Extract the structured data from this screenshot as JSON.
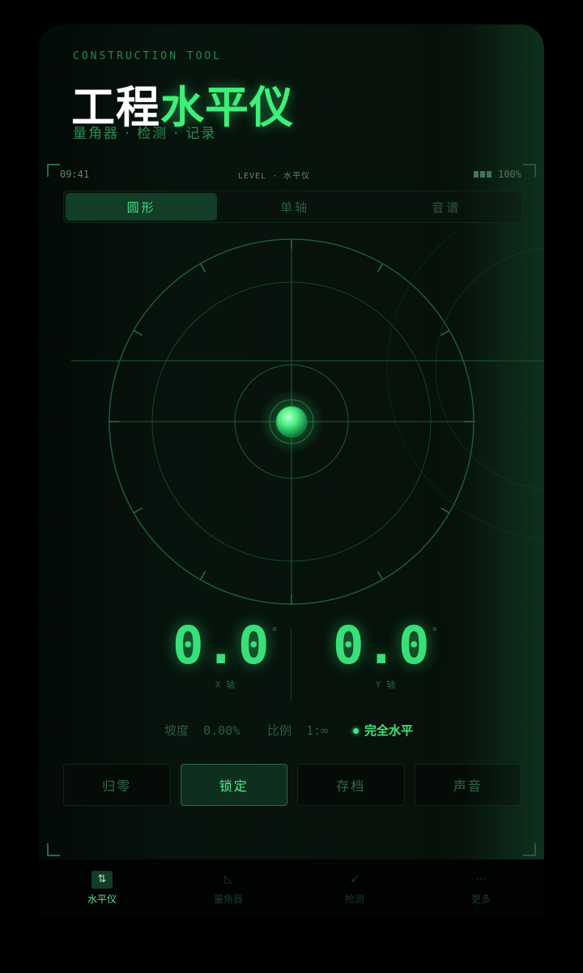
{
  "header": {
    "eyebrow": "CONSTRUCTION TOOL",
    "title_white": "工程",
    "title_green": "水平仪",
    "subtitle": "量角器 · 检测 · 记录"
  },
  "status": {
    "time": "09:41",
    "level_label": "LEVEL · 水平仪",
    "battery": "100%"
  },
  "tabs": [
    {
      "label": "圆形",
      "active": true
    },
    {
      "label": "单轴",
      "active": false
    },
    {
      "label": "音谱",
      "active": false
    }
  ],
  "readings": {
    "x_value": "0.0",
    "x_unit": "°",
    "x_label": "X 轴",
    "y_value": "0.0",
    "y_unit": "°",
    "y_label": "Y 轴"
  },
  "info": {
    "slope_label": "坡度",
    "slope_value": "0.00%",
    "ratio_label": "比例",
    "ratio_value": "1:∞",
    "state": "完全水平"
  },
  "actions": [
    {
      "label": "归零",
      "active": false
    },
    {
      "label": "锁定",
      "active": true
    },
    {
      "label": "存档",
      "active": false
    },
    {
      "label": "声音",
      "active": false
    }
  ],
  "nav": [
    {
      "label": "水平仪",
      "icon": "level-icon",
      "glyph": "⇅",
      "active": true
    },
    {
      "label": "量角器",
      "icon": "protractor-icon",
      "glyph": "◺",
      "active": false
    },
    {
      "label": "检测",
      "icon": "probe-icon",
      "glyph": "↙",
      "active": false
    },
    {
      "label": "更多",
      "icon": "more-icon",
      "glyph": "⋯",
      "active": false
    }
  ],
  "colors": {
    "accent": "#3df07a",
    "bubble": "#49ee82",
    "background": "#07140d"
  }
}
